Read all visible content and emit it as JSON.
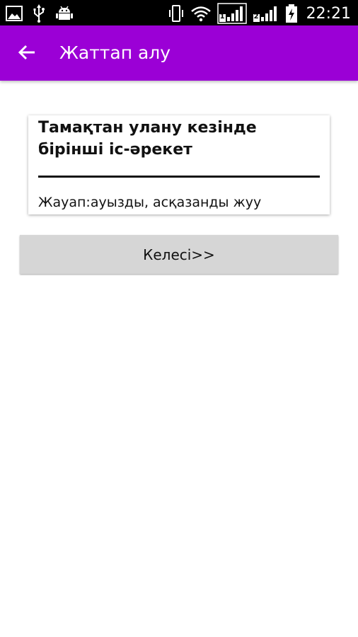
{
  "status_bar": {
    "time": "22:21",
    "icons": [
      "image-icon",
      "usb-icon",
      "android-debug-icon",
      "vibrate-icon",
      "wifi-icon",
      "signal-sim1-icon",
      "signal-sim2-icon",
      "battery-charging-icon"
    ],
    "sim1_label": "1",
    "sim2_label": "2"
  },
  "app_bar": {
    "title": "Жаттап алу",
    "back_icon": "arrow-left-icon",
    "background_color": "#9b00d6"
  },
  "card": {
    "question": "Тамақтан улану кезінде бірінші іс-әрекет",
    "answer": "Жауап:ауызды, асқазанды жуу"
  },
  "next_button": {
    "label": "Келесі>>"
  }
}
